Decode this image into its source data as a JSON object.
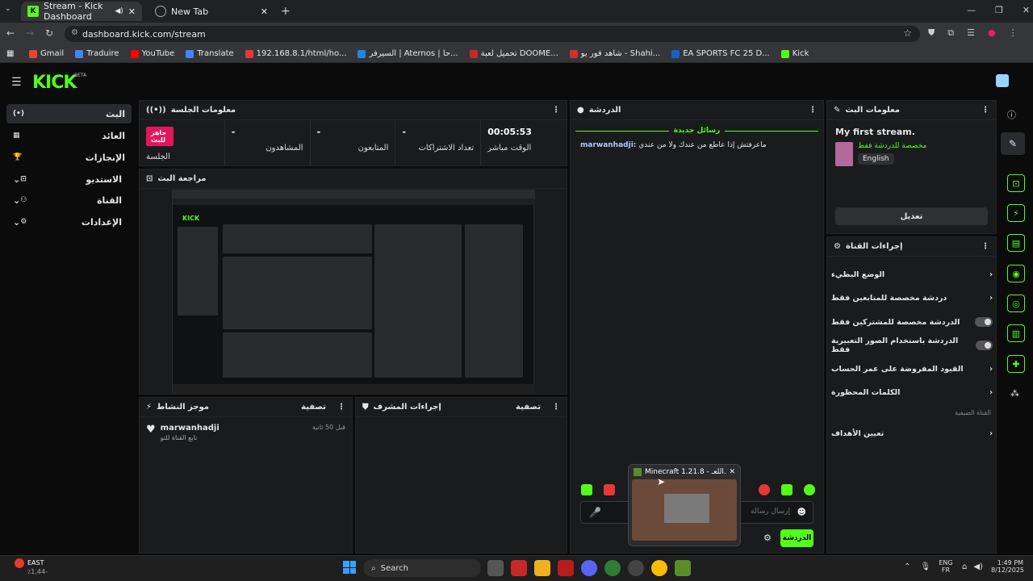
{
  "browser": {
    "tabs": [
      {
        "label": "Stream - Kick Dashboard",
        "favicon": "K"
      },
      {
        "label": "New Tab",
        "favicon": ""
      }
    ],
    "url": "dashboard.kick.com/stream",
    "bookmarks": [
      {
        "label": "Gmail",
        "color": "#ea4335"
      },
      {
        "label": "Traduire",
        "color": "#4285f4"
      },
      {
        "label": "YouTube",
        "color": "#ff0000"
      },
      {
        "label": "Translate",
        "color": "#4285f4"
      },
      {
        "label": "192.168.8.1/html/ho...",
        "color": "#e53935"
      },
      {
        "label": "السيرفر | Aternos | حا...",
        "color": "#1e88e5"
      },
      {
        "label": "تحميل لعبة DOOME...",
        "color": "#c62828"
      },
      {
        "label": "شاهد فور يو - Shahi...",
        "color": "#d32f2f"
      },
      {
        "label": "EA SPORTS FC 25 D...",
        "color": "#1565c0"
      },
      {
        "label": "Kick",
        "color": "#53fc18"
      }
    ]
  },
  "sidebar": {
    "items": [
      {
        "label": "البث",
        "icon": "(•)"
      },
      {
        "label": "العائد",
        "icon": "▦"
      },
      {
        "label": "الإنجازات",
        "icon": "🏆"
      },
      {
        "label": "الاستديو",
        "icon": "⊡"
      },
      {
        "label": "القناة",
        "icon": "⚇"
      },
      {
        "label": "الإعدادات",
        "icon": "⚙"
      }
    ]
  },
  "session": {
    "title": "معلومات الجلسة",
    "live_badge": "جاهز للبث",
    "session_label": "الجلسة",
    "stats": [
      {
        "value": "-",
        "label": "المشاهدون"
      },
      {
        "value": "-",
        "label": "المتابعون"
      },
      {
        "value": "-",
        "label": "تعداد الاشتراكات"
      },
      {
        "value": "00:05:53",
        "label": "الوقت مباشر"
      }
    ]
  },
  "preview": {
    "title": "مراجعة البث"
  },
  "activity": {
    "title": "موجز النشاط",
    "filter": "تصفية",
    "items": [
      {
        "user": "marwanhadji",
        "text": "تابع القناة للتو",
        "time": "قبل 50 ثانية"
      }
    ]
  },
  "moderator": {
    "title": "إجراءات المشرف",
    "filter": "تصفية"
  },
  "chat": {
    "title": "الدردشة",
    "new_messages": "رسائل جديدة",
    "messages": [
      {
        "user": "marwanhadji:",
        "text": "ماعرفتش إذا عاطع من عندك ولا من عندي"
      }
    ],
    "placeholder": "إرسال رسالة",
    "send_label": "الدردشة"
  },
  "stream_info": {
    "title": "معلومات البث",
    "stream_title": "My first stream.",
    "category": "مخصصة للدردشة فقط",
    "language": "English",
    "edit_label": "تعديل"
  },
  "channel_actions": {
    "title": "إجراءات القناة",
    "items": [
      {
        "label": "الوضع البطيء",
        "kind": "chevron"
      },
      {
        "label": "دردشة مخصصة للمتابعين فقط",
        "kind": "chevron"
      },
      {
        "label": "الدردشة مخصصة للمشتركين فقط",
        "kind": "toggle"
      },
      {
        "label": "الدردشة باستخدام الصور التعبيرية فقط",
        "kind": "toggle"
      },
      {
        "label": "القيود المفروضة على عمر الحساب",
        "kind": "chevron"
      },
      {
        "label": "الكلمات المحظورة",
        "kind": "chevron"
      }
    ],
    "section_label": "القناة الضيفية",
    "goals_label": "تعيين الأهداف"
  },
  "popup": {
    "title": "Minecraft 1.21.8 - اللعـ..."
  },
  "taskbar": {
    "weather_label": "EAST",
    "weather_value": "٪1,44-",
    "search_label": "Search",
    "lang_top": "ENG",
    "lang_bottom": "FR",
    "time": "1:49 PM",
    "date": "8/12/2025"
  },
  "colors": {
    "accent": "#53fc18",
    "live": "#e3165b",
    "panel": "#1a1b1d"
  }
}
